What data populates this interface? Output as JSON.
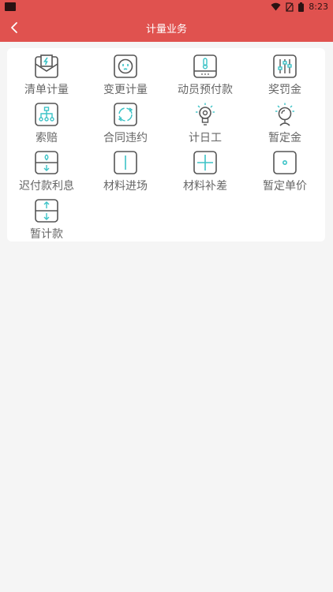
{
  "status_bar": {
    "time": "8:23"
  },
  "app_bar": {
    "title": "计量业务"
  },
  "colors": {
    "accent": "#e0524f",
    "icon_stroke": "#555555",
    "icon_teal": "#3cc3c7"
  },
  "menu": {
    "items": [
      {
        "label": "清单计量",
        "icon": "bill-quantity-icon"
      },
      {
        "label": "变更计量",
        "icon": "change-quantity-icon"
      },
      {
        "label": "动员预付款",
        "icon": "mobilization-prepayment-icon"
      },
      {
        "label": "奖罚金",
        "icon": "reward-penalty-icon"
      },
      {
        "label": "索赔",
        "icon": "claim-icon"
      },
      {
        "label": "合同违约",
        "icon": "contract-breach-icon"
      },
      {
        "label": "计日工",
        "icon": "daywork-icon"
      },
      {
        "label": "暂定金",
        "icon": "provisional-sum-icon"
      },
      {
        "label": "迟付款利息",
        "icon": "late-payment-interest-icon"
      },
      {
        "label": "材料进场",
        "icon": "material-entry-icon"
      },
      {
        "label": "材料补差",
        "icon": "material-difference-icon"
      },
      {
        "label": "暂定单价",
        "icon": "provisional-unit-price-icon"
      },
      {
        "label": "暂计款",
        "icon": "provisional-payment-icon"
      }
    ]
  }
}
